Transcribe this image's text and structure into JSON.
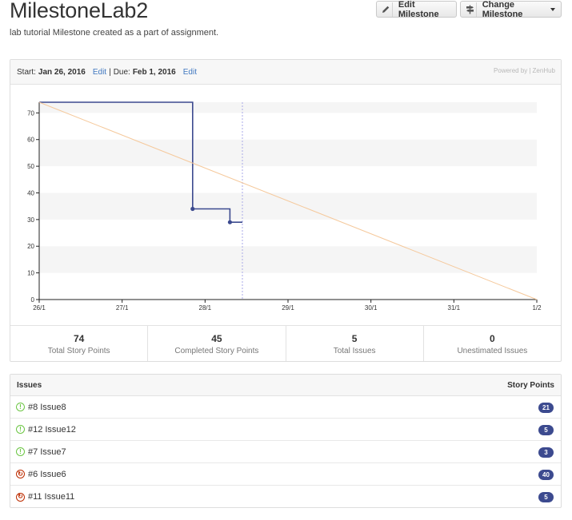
{
  "header": {
    "title": "MilestoneLab2",
    "description": "lab tutorial Milestone created as a part of assignment.",
    "edit_button": "Edit Milestone",
    "change_button": "Change Milestone"
  },
  "milestone": {
    "start_label": "Start:",
    "start_date": "Jan 26, 2016",
    "edit_start": "Edit",
    "separator": "|",
    "due_label": "Due:",
    "due_date": "Feb 1, 2016",
    "edit_due": "Edit",
    "powered_by": "Powered by |",
    "brand": "ZenHub"
  },
  "chart_data": {
    "type": "line",
    "x_categories": [
      "26/1",
      "27/1",
      "28/1",
      "29/1",
      "30/1",
      "31/1",
      "1/2"
    ],
    "xlim": [
      0,
      6
    ],
    "ylim": [
      0,
      74
    ],
    "yticks": [
      0,
      10,
      20,
      30,
      40,
      50,
      60,
      70
    ],
    "grid": "alternating horizontal bands",
    "series": [
      {
        "name": "",
        "style": "step",
        "color": "#3c4a8f",
        "points": [
          {
            "x": 0,
            "y": 74
          },
          {
            "x": 1.85,
            "y": 74
          },
          {
            "x": 1.85,
            "y": 34
          },
          {
            "x": 2.3,
            "y": 34
          },
          {
            "x": 2.3,
            "y": 29
          },
          {
            "x": 2.45,
            "y": 29
          }
        ],
        "markers": [
          {
            "x": 1.85,
            "y": 34
          },
          {
            "x": 2.3,
            "y": 29
          }
        ]
      },
      {
        "name": "",
        "style": "ideal",
        "color": "#f5c89a",
        "points": [
          {
            "x": 0,
            "y": 74
          },
          {
            "x": 6,
            "y": 0
          }
        ]
      }
    ],
    "today_marker": {
      "x": 2.45,
      "color": "#a9a9e8"
    }
  },
  "stats": [
    {
      "value": "74",
      "label": "Total Story Points"
    },
    {
      "value": "45",
      "label": "Completed Story Points"
    },
    {
      "value": "5",
      "label": "Total Issues"
    },
    {
      "value": "0",
      "label": "Unestimated Issues"
    }
  ],
  "issues": {
    "header_left": "Issues",
    "header_right": "Story Points",
    "items": [
      {
        "number": "#8",
        "title": "Issue8",
        "points": "21",
        "state": "open"
      },
      {
        "number": "#12",
        "title": "Issue12",
        "points": "5",
        "state": "open"
      },
      {
        "number": "#7",
        "title": "Issue7",
        "points": "3",
        "state": "open"
      },
      {
        "number": "#6",
        "title": "Issue6",
        "points": "40",
        "state": "closed"
      },
      {
        "number": "#11",
        "title": "Issue11",
        "points": "5",
        "state": "closed"
      }
    ]
  },
  "colors": {
    "accent": "#3c4a8f",
    "link": "#4078c0",
    "open": "#6cc644",
    "closed": "#bd2c00"
  }
}
